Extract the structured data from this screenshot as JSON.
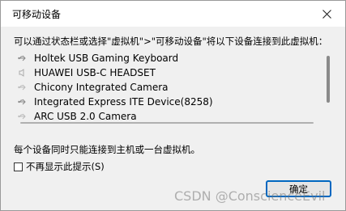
{
  "window": {
    "title": "可移动设备",
    "close_icon": "close-icon"
  },
  "prompt": "可以通过状态栏或选择\"虚拟机\">\"可移动设备\"将以下设备连接到此虚拟机：",
  "devices": [
    {
      "label": "Holtek USB Gaming Keyboard",
      "icon": "usb-icon"
    },
    {
      "label": "HUAWEI USB-C HEADSET",
      "icon": "audio-icon"
    },
    {
      "label": "Chicony Integrated Camera",
      "icon": "usb-icon"
    },
    {
      "label": "Integrated Express ITE Device(8258)",
      "icon": "usb-icon"
    },
    {
      "label": "ARC USB 2.0 Camera",
      "icon": "usb-icon"
    }
  ],
  "info": "每个设备同时只能连接到主机或一台虚拟机。",
  "checkbox": {
    "label": "不再显示此提示(S)",
    "checked": false
  },
  "ok_button": "确定",
  "watermark": "CSDN @ConscienceEvil"
}
